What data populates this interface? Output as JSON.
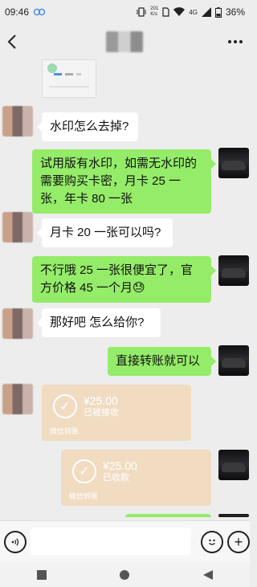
{
  "status_bar": {
    "time": "09:46",
    "speed_top": "201",
    "speed_bottom": "K/s",
    "network": "4G",
    "battery": "36%"
  },
  "messages": {
    "m1": "水印怎么去掉?",
    "m2": "试用版有水印，如需无水印的需要购买卡密，月卡 25 一张，年卡 80 一张",
    "m3": "月卡 20 一张可以吗?",
    "m4_text": "不行哦 25 一张很便宜了，官方价格 45 一个月",
    "m4_emoji": "😓",
    "m5": "那好吧 怎么给你?",
    "m6": "直接转账就可以"
  },
  "transfers": {
    "t1": {
      "amount": "¥25.00",
      "status": "已被接收",
      "footer": "微信转账"
    },
    "t2": {
      "amount": "¥25.00",
      "status": "已收款",
      "footer": "微信转账"
    }
  },
  "icons": [
    "back-arrow-icon",
    "more-icon",
    "voice-icon",
    "emoji-icon",
    "plus-icon",
    "home-icon",
    "recent-icon",
    "back-nav-icon"
  ]
}
